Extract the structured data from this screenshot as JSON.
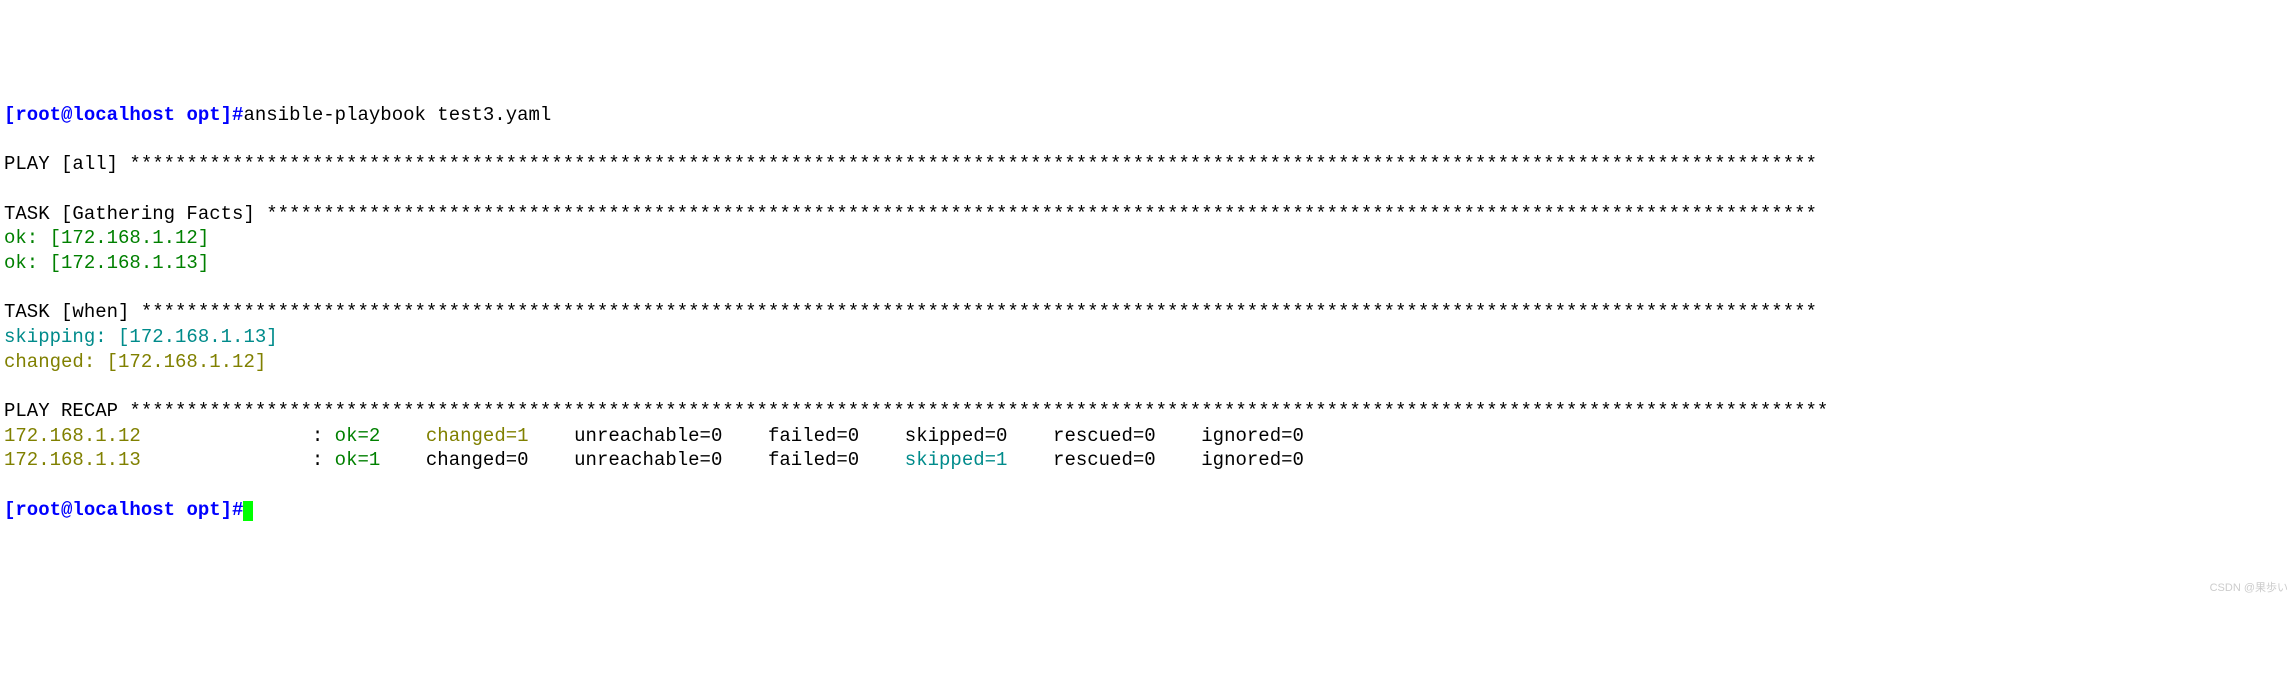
{
  "prompt": {
    "user_host": "[root@localhost ",
    "dir": "opt",
    "bracket": "]#",
    "command": "ansible-playbook test3.yaml"
  },
  "play_header": {
    "label": "PLAY [all] ",
    "stars": "****************************************************************************************************************************************************"
  },
  "task_gathering": {
    "label": "TASK [Gathering Facts] ",
    "stars": "****************************************************************************************************************************************"
  },
  "ok_hosts": [
    "ok: [172.168.1.12]",
    "ok: [172.168.1.13]"
  ],
  "task_when": {
    "label": "TASK [when] ",
    "stars": "***************************************************************************************************************************************************"
  },
  "skipping": "skipping: [172.168.1.13]",
  "changed": "changed: [172.168.1.12]",
  "play_recap": {
    "label": "PLAY RECAP ",
    "stars": "*****************************************************************************************************************************************************"
  },
  "recap_rows": [
    {
      "host": "172.168.1.12               ",
      "colon": ": ",
      "ok": "ok=2   ",
      "changed": " changed=1   ",
      "unreachable": " unreachable=0   ",
      "failed": " failed=0   ",
      "skipped": " skipped=0   ",
      "rescued": " rescued=0   ",
      "ignored": " ignored=0   "
    },
    {
      "host": "172.168.1.13               ",
      "colon": ": ",
      "ok": "ok=1   ",
      "changed": " changed=0   ",
      "unreachable": " unreachable=0   ",
      "failed": " failed=0   ",
      "skipped": " skipped=1   ",
      "rescued": " rescued=0   ",
      "ignored": " ignored=0   "
    }
  ],
  "prompt2": {
    "user_host": "[root@localhost ",
    "dir": "opt",
    "bracket": "]#"
  },
  "watermark": "CSDN @果歩い"
}
